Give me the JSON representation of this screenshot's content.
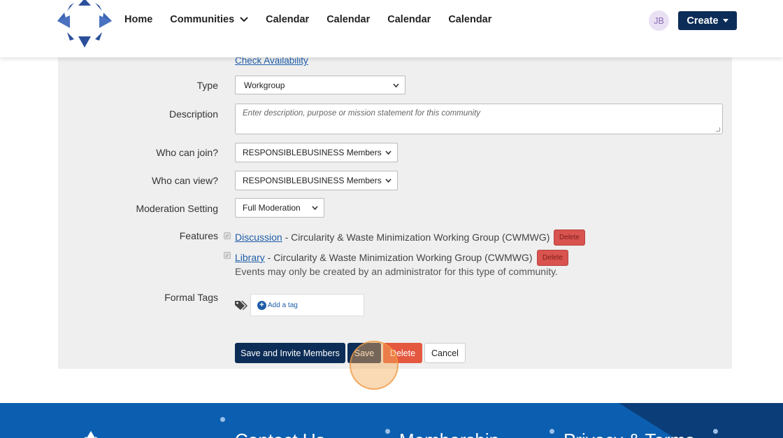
{
  "header": {
    "nav": [
      {
        "label": "Home"
      },
      {
        "label": "Communities"
      },
      {
        "label": "Calendar"
      },
      {
        "label": "Calendar"
      },
      {
        "label": "Calendar"
      },
      {
        "label": "Calendar"
      }
    ],
    "avatar_initials": "JB",
    "create_label": "Create"
  },
  "form": {
    "check_availability": "Check Availability",
    "type": {
      "label": "Type",
      "value": "Workgroup"
    },
    "description": {
      "label": "Description",
      "placeholder": "Enter description, purpose or mission statement for this community"
    },
    "who_can_join": {
      "label": "Who can join?",
      "value": "RESPONSIBLEBUSINESS Members"
    },
    "who_can_view": {
      "label": "Who can view?",
      "value": "RESPONSIBLEBUSINESS Members"
    },
    "moderation": {
      "label": "Moderation Setting",
      "value": "Full Moderation"
    },
    "features": {
      "label": "Features",
      "items": [
        {
          "link": "Discussion",
          "text": " - Circularity & Waste Minimization Working Group (CWMWG)",
          "delete": "Delete"
        },
        {
          "link": "Library",
          "text": " - Circularity & Waste Minimization Working Group (CWMWG)",
          "delete": "Delete"
        }
      ],
      "note": "Events may only be created by an administrator for this type of community."
    },
    "formal_tags": {
      "label": "Formal Tags",
      "add_label": "Add a tag"
    },
    "buttons": {
      "save_invite": "Save and Invite Members",
      "save": "Save",
      "delete": "Delete",
      "cancel": "Cancel"
    }
  },
  "footer": {
    "headings": [
      "Contact Us",
      "Membership",
      "Privacy & Terms"
    ]
  },
  "colors": {
    "brand_navy": "#0c2d57",
    "link_blue": "#1f5ea8",
    "danger": "#d9534f",
    "footer_blue": "#0c5fb0"
  }
}
